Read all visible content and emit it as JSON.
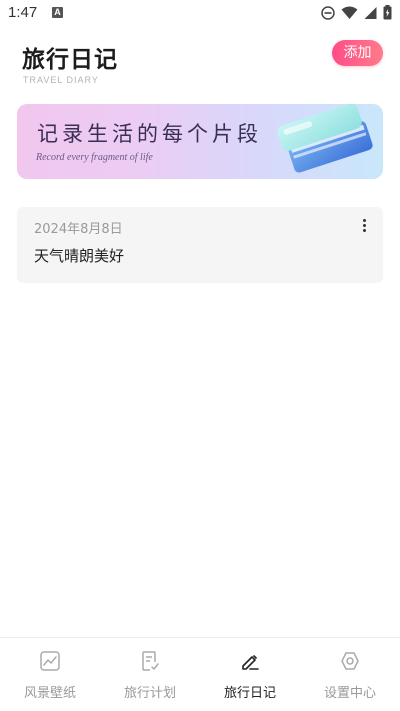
{
  "status_bar": {
    "time": "1:47",
    "notification_letter": "A"
  },
  "header": {
    "title": "旅行日记",
    "subtitle": "TRAVEL DIARY",
    "add_label": "添加"
  },
  "banner": {
    "title": "记录生活的每个片段",
    "subtitle": "Record every fragment of life"
  },
  "diary_entries": [
    {
      "date": "2024年8月8日",
      "content": "天气晴朗美好"
    }
  ],
  "bottom_nav": {
    "items": [
      {
        "label": "风景壁纸",
        "icon": "wallpaper-icon",
        "active": false
      },
      {
        "label": "旅行计划",
        "icon": "plan-icon",
        "active": false
      },
      {
        "label": "旅行日记",
        "icon": "edit-diary-icon",
        "active": true
      },
      {
        "label": "设置中心",
        "icon": "settings-icon",
        "active": false
      }
    ]
  },
  "colors": {
    "accent_start": "#ff4d88",
    "accent_end": "#ff7b8a",
    "inactive": "#999999",
    "active": "#222222"
  }
}
